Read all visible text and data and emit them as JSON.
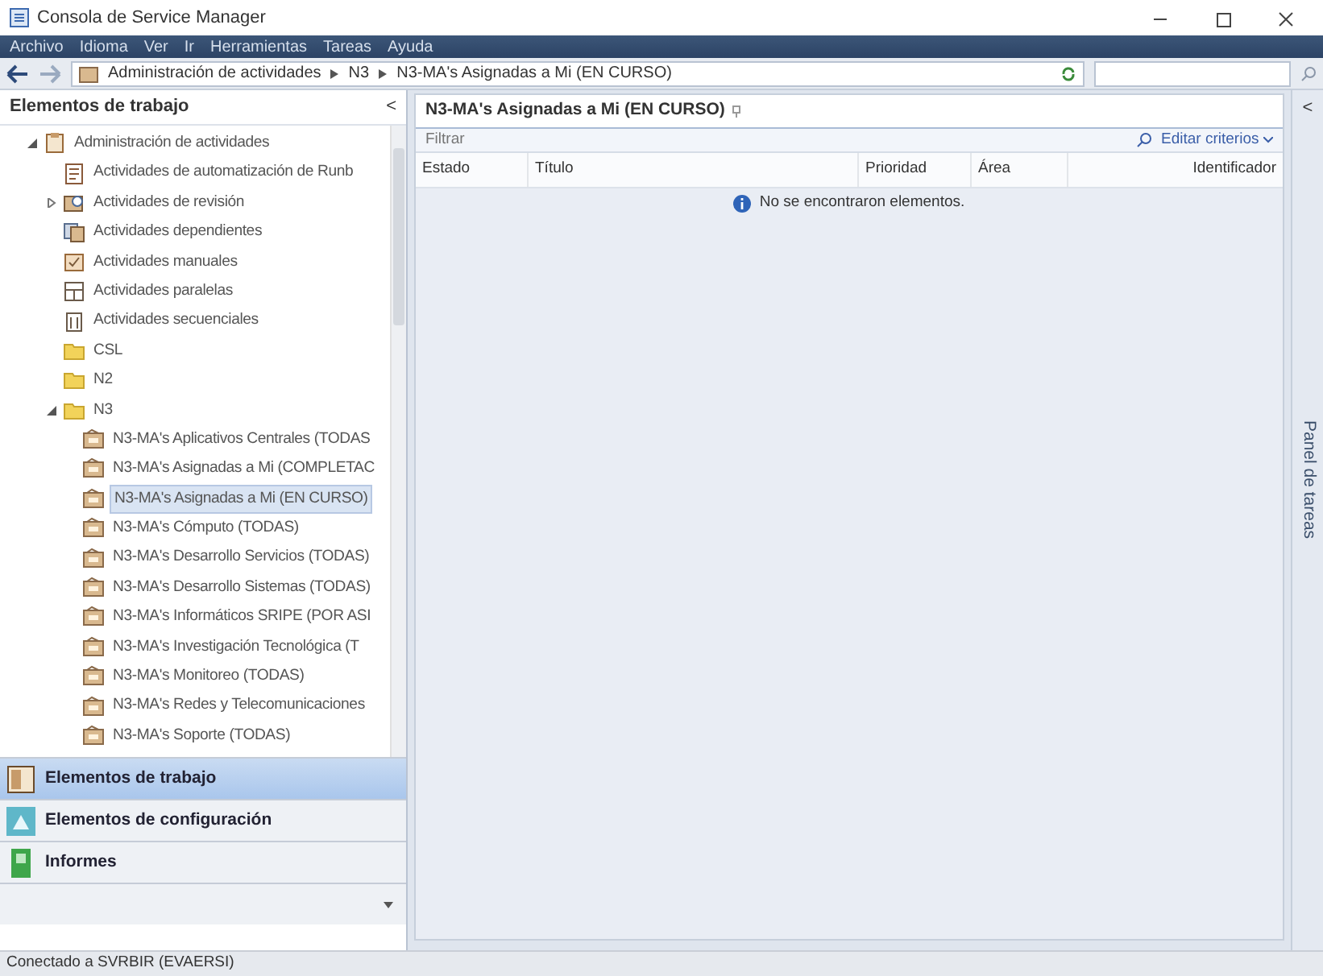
{
  "window": {
    "title": "Consola de Service Manager"
  },
  "menu": [
    "Archivo",
    "Idioma",
    "Ver",
    "Ir",
    "Herramientas",
    "Tareas",
    "Ayuda"
  ],
  "breadcrumb": [
    "Administración de actividades",
    "N3",
    "N3-MA's Asignadas a Mi (EN CURSO)"
  ],
  "sidebar": {
    "title": "Elementos de trabajo",
    "collapse": "<",
    "tree": [
      {
        "label": "Administración de actividades",
        "kind": "group",
        "expanded": true,
        "selected": false,
        "children": [
          {
            "label": "Actividades de automatización de Runb",
            "kind": "runbook",
            "selected": false
          },
          {
            "label": "Actividades de revisión",
            "kind": "review",
            "expanded": false,
            "selected": false
          },
          {
            "label": "Actividades dependientes",
            "kind": "dependent",
            "selected": false
          },
          {
            "label": "Actividades manuales",
            "kind": "manual",
            "selected": false
          },
          {
            "label": "Actividades paralelas",
            "kind": "parallel",
            "selected": false
          },
          {
            "label": "Actividades secuenciales",
            "kind": "sequential",
            "selected": false
          },
          {
            "label": "CSL",
            "kind": "folder",
            "selected": false
          },
          {
            "label": "N2",
            "kind": "folder",
            "selected": false
          },
          {
            "label": "N3",
            "kind": "folder",
            "expanded": true,
            "selected": false,
            "children": [
              {
                "label": "N3-MA's Aplicativos Centrales (TODAS",
                "kind": "view",
                "selected": false
              },
              {
                "label": "N3-MA's Asignadas a Mi (COMPLETAC",
                "kind": "view",
                "selected": false
              },
              {
                "label": "N3-MA's Asignadas a Mi (EN CURSO)",
                "kind": "view",
                "selected": true
              },
              {
                "label": "N3-MA's Cómputo (TODAS)",
                "kind": "view",
                "selected": false
              },
              {
                "label": "N3-MA's Desarrollo Servicios (TODAS)",
                "kind": "view",
                "selected": false
              },
              {
                "label": "N3-MA's Desarrollo Sistemas (TODAS)",
                "kind": "view",
                "selected": false
              },
              {
                "label": "N3-MA's Informáticos SRIPE (POR ASI",
                "kind": "view",
                "selected": false
              },
              {
                "label": "N3-MA's Investigación Tecnológica (T",
                "kind": "view",
                "selected": false
              },
              {
                "label": "N3-MA's Monitoreo (TODAS)",
                "kind": "view",
                "selected": false
              },
              {
                "label": "N3-MA's Redes y Telecomunicaciones",
                "kind": "view",
                "selected": false
              },
              {
                "label": "N3-MA's Soporte (TODAS)",
                "kind": "view",
                "selected": false
              }
            ]
          }
        ]
      }
    ]
  },
  "nav_buttons": [
    {
      "label": "Elementos de trabajo",
      "kind": "work",
      "selected": true
    },
    {
      "label": "Elementos de configuración",
      "kind": "config",
      "selected": false
    },
    {
      "label": "Informes",
      "kind": "reports",
      "selected": false
    }
  ],
  "view": {
    "title": "N3-MA's Asignadas a Mi (EN CURSO)",
    "filter": {
      "placeholder": "Filtrar"
    },
    "edit_criteria": "Editar criterios",
    "columns": [
      "Estado",
      "Título",
      "Prioridad",
      "Área",
      "Identificador"
    ],
    "empty_message": "No se encontraron elementos."
  },
  "task_panel": {
    "title": "Panel de tareas",
    "collapse": "<"
  },
  "status_bar": "Conectado a SVRBIR (EVAERSI)"
}
